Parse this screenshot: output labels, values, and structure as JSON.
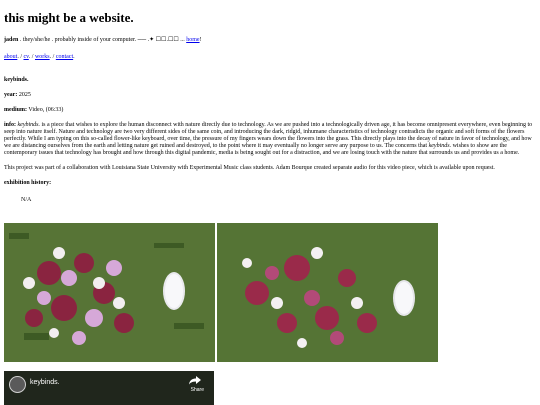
{
  "site": {
    "title": "this might be a website."
  },
  "byline": {
    "name": "jaden",
    "rest": " . they/she/he . probably inside of your computer. ── .✦ ☐☐.☐☐ ... ",
    "home_link": "home",
    "end": "!"
  },
  "nav": [
    {
      "label": "about",
      "sep": ". / "
    },
    {
      "label": "cv",
      "sep": ". / "
    },
    {
      "label": "works",
      "sep": ". / "
    },
    {
      "label": "contact",
      "sep": "."
    }
  ],
  "work": {
    "title": "keybinds.",
    "year_label": "year:",
    "year": " 2025",
    "medium_label": "medium:",
    "medium": " Video, (06:33)",
    "info_label": "info:",
    "info_title": "keybinds.",
    "info_text_1": " is a piece that wishes to explore the human disconnect with nature directly due to technology. As we are pushed into a technologically driven age, it has become omnipresent everywhere, even beginning to seep into nature itself. Nature and technology are two very different sides of the same coin, and introducing the dark, ridgid, inhumane characteristics of technology contradicts the organic and soft forms of the flowers perfectly. While I am typing on this so-called flower-like keyboard, over time, the pressure of my fingers wears down the flowers into the grass. This directly plays into the decay of nature in favor of technology, and how we are distancing ourselves from the earth and letting nature get ruined and destroyed, to the point where it may eventually no longer serve any purpose to us. The concerns that ",
    "info_title_2": "keybinds.",
    "info_text_2": " wishes to show are the contemporary issues that technology has brought and how through this digital pandemic, media is being sought out for a distraction, and we are losing touch with the nature that surrounds us and provides us a home.",
    "collab": "This project was part of a collaboration with Louisiana State University with Experimental Music class students. Adam Bourque created separate audio for this video piece, which is available upon request.",
    "exhibition_label": "exhibition history:",
    "exhibition_value": "N/A"
  },
  "video": {
    "title": "keybinds.",
    "share_label": "Share",
    "icons": [
      "channel-avatar-icon",
      "share-icon"
    ]
  },
  "colors": {
    "link": "#0000ee",
    "text": "#000000",
    "video_bg": "#20261c"
  }
}
